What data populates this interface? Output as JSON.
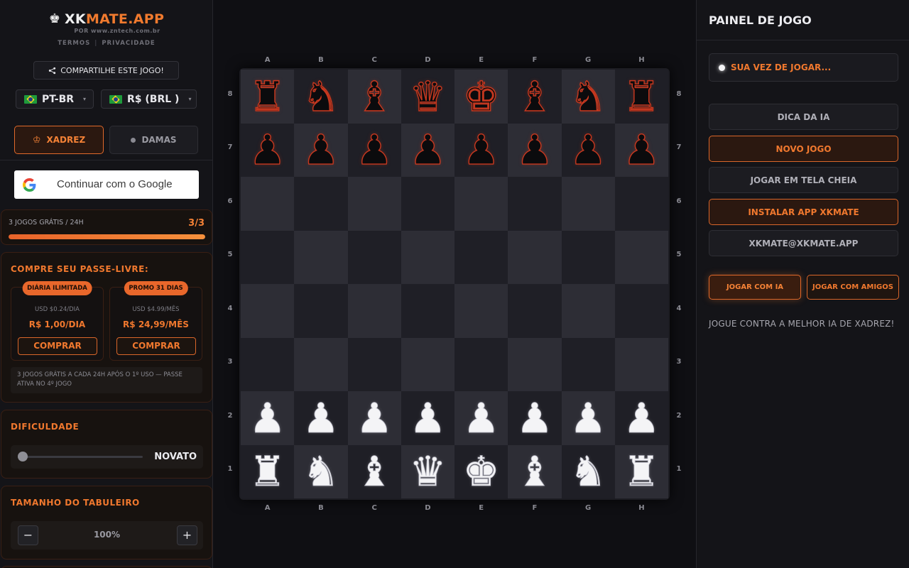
{
  "brand": {
    "name_white": "XK",
    "name_orange": "MATE.APP",
    "byline": "POR www.zntech.com.br",
    "link_terms": "TERMOS",
    "link_privacy": "PRIVACIDADE"
  },
  "share_label": "COMPARTILHE ESTE JOGO!",
  "language": {
    "selected": "PT-BR"
  },
  "currency": {
    "selected": "R$ (BRL )"
  },
  "modes": {
    "chess": "XADREZ",
    "checkers": "DAMAS"
  },
  "google_label": "Continuar com o Google",
  "free_games": {
    "label": "3 JOGOS GRÁTIS / 24H",
    "count": "3/3",
    "progress": 1.0
  },
  "pass": {
    "title": "COMPRE SEU PASSE-LIVRE:",
    "plans": [
      {
        "badge": "DIÁRIA ILIMITADA",
        "usd": "USD $0.24/DIA",
        "brl": "R$ 1,00/DIA",
        "buy": "COMPRAR"
      },
      {
        "badge": "PROMO 31 DIAS",
        "usd": "USD $4.99/MÊS",
        "brl": "R$ 24,99/MÊS",
        "buy": "COMPRAR"
      }
    ],
    "note": "3 JOGOS GRÁTIS A CADA 24H APÓS O 1º USO — PASSE ATIVA NO 4º JOGO"
  },
  "difficulty": {
    "title": "DIFICULDADE",
    "level": "NOVATO",
    "value": 0
  },
  "board_size": {
    "title": "TAMANHO DO TABULEIRO",
    "minus": "−",
    "plus": "+",
    "value": "100%"
  },
  "board": {
    "files": [
      "A",
      "B",
      "C",
      "D",
      "E",
      "F",
      "G",
      "H"
    ],
    "ranks": [
      "8",
      "7",
      "6",
      "5",
      "4",
      "3",
      "2",
      "1"
    ],
    "position": [
      [
        "bR",
        "bN",
        "bB",
        "bQ",
        "bK",
        "bB",
        "bN",
        "bR"
      ],
      [
        "bP",
        "bP",
        "bP",
        "bP",
        "bP",
        "bP",
        "bP",
        "bP"
      ],
      [
        "",
        "",
        "",
        "",
        "",
        "",
        "",
        ""
      ],
      [
        "",
        "",
        "",
        "",
        "",
        "",
        "",
        ""
      ],
      [
        "",
        "",
        "",
        "",
        "",
        "",
        "",
        ""
      ],
      [
        "",
        "",
        "",
        "",
        "",
        "",
        "",
        ""
      ],
      [
        "wP",
        "wP",
        "wP",
        "wP",
        "wP",
        "wP",
        "wP",
        "wP"
      ],
      [
        "wR",
        "wN",
        "wB",
        "wQ",
        "wK",
        "wB",
        "wN",
        "wR"
      ]
    ]
  },
  "panel": {
    "title": "PAINEL DE JOGO",
    "turn": "SUA VEZ DE JOGAR...",
    "buttons": {
      "hint": "DICA DA IA",
      "new_game": "NOVO JOGO",
      "fullscreen": "JOGAR EM TELA CHEIA",
      "install": "INSTALAR APP XKMATE",
      "email": "XKMATE@XKMATE.APP"
    },
    "play_ai": "JOGAR COM IA",
    "play_friends": "JOGAR COM AMIGOS",
    "tagline": "JOGUE CONTRA A MELHOR IA DE XADREZ!"
  },
  "colors": {
    "accent": "#f0782e",
    "background": "#0e0e12",
    "panel": "#141418"
  }
}
